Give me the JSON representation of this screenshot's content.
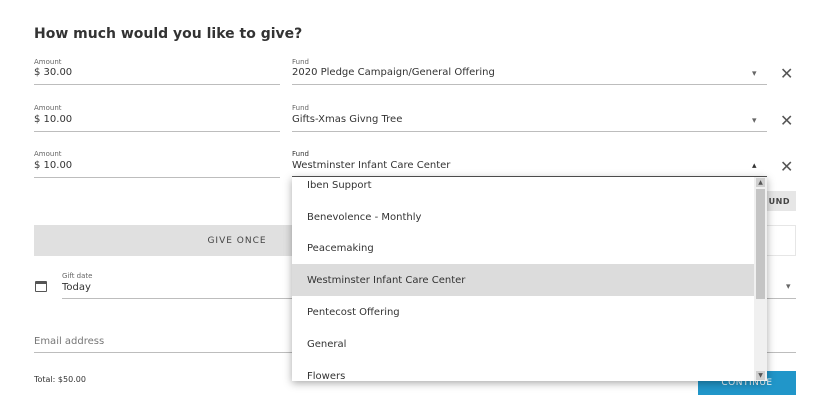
{
  "title": "How much would you like to give?",
  "rows": [
    {
      "amount_label": "Amount",
      "amount": "$ 30.00",
      "fund_label": "Fund",
      "fund": "2020 Pledge Campaign/General Offering"
    },
    {
      "amount_label": "Amount",
      "amount": "$ 10.00",
      "fund_label": "Fund",
      "fund": "Gifts-Xmas Givng Tree"
    },
    {
      "amount_label": "Amount",
      "amount": "$ 10.00",
      "fund_label": "Fund",
      "fund": "Westminster Infant Care Center"
    }
  ],
  "add_fund_label": "UND",
  "give_once_label": "GIVE ONCE",
  "gift_date": {
    "label": "Gift date",
    "value": "Today"
  },
  "email": {
    "placeholder": "Email address"
  },
  "total": "Total: $50.00",
  "continue_label": "CONTINUE",
  "fund_dropdown": {
    "options": [
      "Iben Support",
      "Benevolence - Monthly",
      "Peacemaking",
      "Westminster Infant Care Center",
      "Pentecost Offering",
      "General",
      "Flowers"
    ],
    "selected": "Westminster Infant Care Center"
  },
  "icons": {
    "dropdown": "chevron-down-icon",
    "dropdown_open": "chevron-up-icon",
    "remove": "close-icon",
    "calendar": "calendar-icon"
  }
}
